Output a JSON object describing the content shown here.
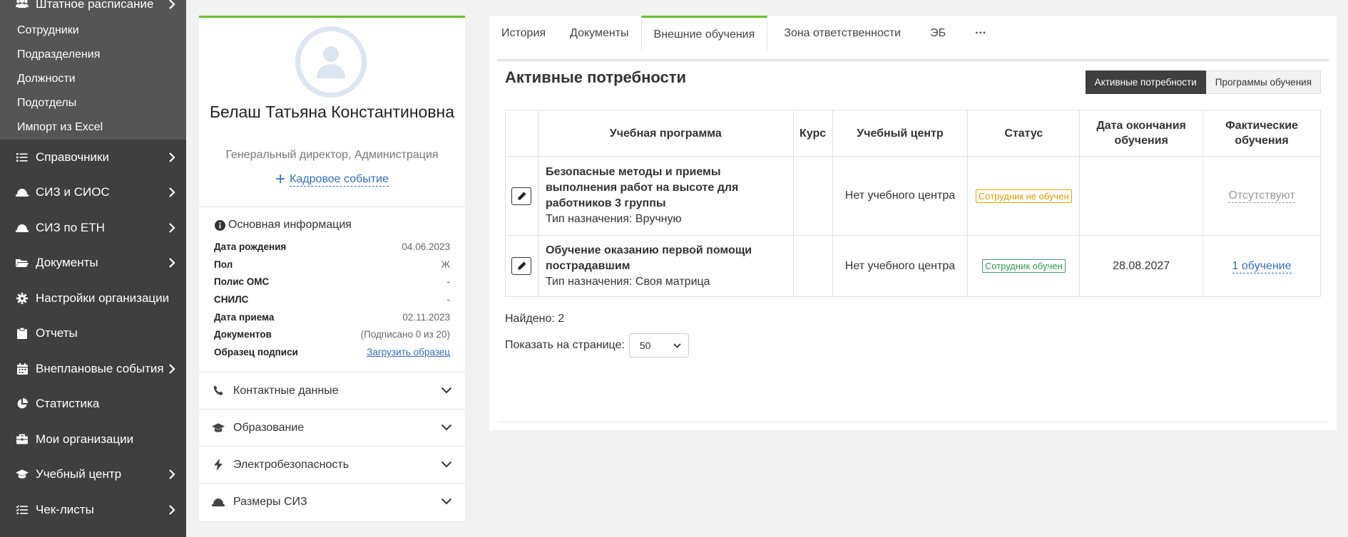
{
  "sidebar": {
    "top_item": "Штатное расписание",
    "sub_items": [
      "Сотрудники",
      "Подразделения",
      "Должности",
      "Подотделы",
      "Импорт из Excel"
    ],
    "items": [
      {
        "label": "Справочники",
        "icon": "list-icon",
        "chevron": true
      },
      {
        "label": "СИЗ и СИОС",
        "icon": "helmet-icon",
        "chevron": true
      },
      {
        "label": "СИЗ по ЕТН",
        "icon": "helmet-icon",
        "chevron": true
      },
      {
        "label": "Документы",
        "icon": "folder-icon",
        "chevron": true
      },
      {
        "label": "Настройки организации",
        "icon": "gear-icon",
        "chevron": false
      },
      {
        "label": "Отчеты",
        "icon": "clipboard-icon",
        "chevron": false
      },
      {
        "label": "Внеплановые события",
        "icon": "calendar-icon",
        "chevron": true
      },
      {
        "label": "Статистика",
        "icon": "pie-chart-icon",
        "chevron": false
      },
      {
        "label": "Мои организации",
        "icon": "briefcase-icon",
        "chevron": false
      },
      {
        "label": "Учебный центр",
        "icon": "graduation-cap-icon",
        "chevron": true
      },
      {
        "label": "Чек-листы",
        "icon": "checklist-icon",
        "chevron": true
      }
    ]
  },
  "profile": {
    "name": "Белаш Татьяна Константиновна",
    "position": "Генеральный директор, Администрация",
    "event_link": "Кадровое событие",
    "info_title": "Основная информация",
    "rows": [
      {
        "k": "Дата рождения",
        "v": "04.06.2023"
      },
      {
        "k": "Пол",
        "v": "Ж"
      },
      {
        "k": "Полис ОМС",
        "v": "-"
      },
      {
        "k": "СНИЛС",
        "v": "-"
      },
      {
        "k": "Дата приема",
        "v": "02.11.2023"
      },
      {
        "k": "Документов",
        "v": "(Подписано 0 из 20)"
      },
      {
        "k": "Образец подписи",
        "v": "Загрузить образец"
      }
    ],
    "sections": [
      "Контактные данные",
      "Образование",
      "Электробезопасность",
      "Размеры СИЗ"
    ]
  },
  "tabs": [
    "История",
    "Документы",
    "Внешние обучения",
    "Зона ответственности",
    "ЭБ",
    "···"
  ],
  "main": {
    "title": "Активные потребности",
    "toggle": [
      "Активные потребности",
      "Программы обучения"
    ],
    "columns": [
      "",
      "Учебная программа",
      "Курс",
      "Учебный центр",
      "Статус",
      "Дата окончания обучения",
      "Фактические обучения"
    ],
    "rows": [
      {
        "program": "Безопасные методы и приемы выполнения работ на высоте для работников 3 группы",
        "assign": "Тип назначения: Вручную",
        "course": "",
        "center": "Нет учебного центра",
        "status": "Сотрудник не обучен",
        "end_date": "",
        "actual": "Отсутствуют"
      },
      {
        "program": "Обучение оказанию первой помощи пострадавшим",
        "assign": "Тип назначения: Своя матрица",
        "course": "",
        "center": "Нет учебного центра",
        "status": "Сотрудник обучен",
        "end_date": "28.08.2027",
        "actual": "1 обучение"
      }
    ],
    "found": "Найдено: 2",
    "per_page_label": "Показать на странице:",
    "per_page_value": "50"
  },
  "colors": {
    "accent": "#6cbf2a",
    "sidebar": "#3f3f3f",
    "link": "#2f6fbd",
    "warn": "#e09a00",
    "ok": "#2e9a4f"
  }
}
